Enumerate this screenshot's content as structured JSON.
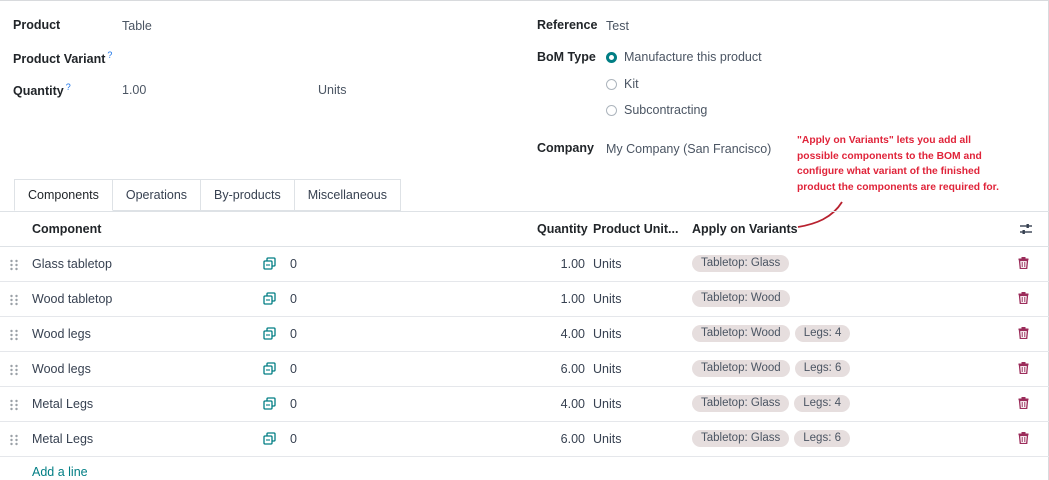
{
  "form": {
    "product_label": "Product",
    "product_value": "Table",
    "variant_label": "Product Variant",
    "variant_help": "?",
    "quantity_label": "Quantity",
    "quantity_help": "?",
    "quantity_value": "1.00",
    "quantity_uom": "Units",
    "reference_label": "Reference",
    "reference_value": "Test",
    "bom_type_label": "BoM Type",
    "bom_type_options": [
      "Manufacture this product",
      "Kit",
      "Subcontracting"
    ],
    "bom_type_selected": "Manufacture this product",
    "company_label": "Company",
    "company_value": "My Company (San Francisco)"
  },
  "annotation": {
    "text": "\"Apply on Variants\" lets you add all possible components to the BOM and configure what variant of the finished product the components are required for.",
    "color": "#e0243a"
  },
  "tabs": [
    "Components",
    "Operations",
    "By-products",
    "Miscellaneous"
  ],
  "active_tab": "Components",
  "table": {
    "headers": {
      "component": "Component",
      "quantity": "Quantity",
      "uom": "Product Unit...",
      "variants": "Apply on Variants"
    },
    "rows": [
      {
        "component": "Glass tabletop",
        "zero": "0",
        "quantity": "1.00",
        "uom": "Units",
        "variants": [
          "Tabletop: Glass"
        ]
      },
      {
        "component": "Wood tabletop",
        "zero": "0",
        "quantity": "1.00",
        "uom": "Units",
        "variants": [
          "Tabletop: Wood"
        ]
      },
      {
        "component": "Wood legs",
        "zero": "0",
        "quantity": "4.00",
        "uom": "Units",
        "variants": [
          "Tabletop: Wood",
          "Legs: 4"
        ]
      },
      {
        "component": "Wood legs",
        "zero": "0",
        "quantity": "6.00",
        "uom": "Units",
        "variants": [
          "Tabletop: Wood",
          "Legs: 6"
        ]
      },
      {
        "component": "Metal Legs",
        "zero": "0",
        "quantity": "4.00",
        "uom": "Units",
        "variants": [
          "Tabletop: Glass",
          "Legs: 4"
        ]
      },
      {
        "component": "Metal Legs",
        "zero": "0",
        "quantity": "6.00",
        "uom": "Units",
        "variants": [
          "Tabletop: Glass",
          "Legs: 6"
        ]
      }
    ],
    "add_line": "Add a line"
  },
  "colors": {
    "accent": "#017e84",
    "tag_bg": "#e6dede",
    "trash": "#9b2c5a",
    "copy_icon": "#017e84"
  }
}
